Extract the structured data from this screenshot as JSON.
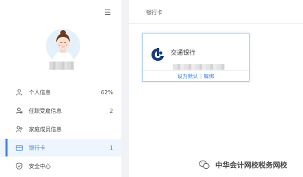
{
  "sidebar": {
    "items": [
      {
        "label": "个人信息",
        "count": "62%",
        "icon": "person-icon"
      },
      {
        "label": "任职受雇信息",
        "count": "2",
        "icon": "person-badge-icon"
      },
      {
        "label": "家庭成员信息",
        "count": "",
        "icon": "family-icon"
      },
      {
        "label": "银行卡",
        "count": "1",
        "icon": "card-icon"
      },
      {
        "label": "安全中心",
        "count": "",
        "icon": "shield-icon"
      }
    ]
  },
  "main": {
    "breadcrumb": "银行卡",
    "card": {
      "bank_name": "交通银行",
      "set_default": "设为默认",
      "separator": "|",
      "unbind": "解绑"
    }
  },
  "watermark": {
    "text": "中华会计网校税务网校"
  },
  "colors": {
    "accent": "#3a83e0",
    "bank_logo": "#1a3d7c"
  }
}
